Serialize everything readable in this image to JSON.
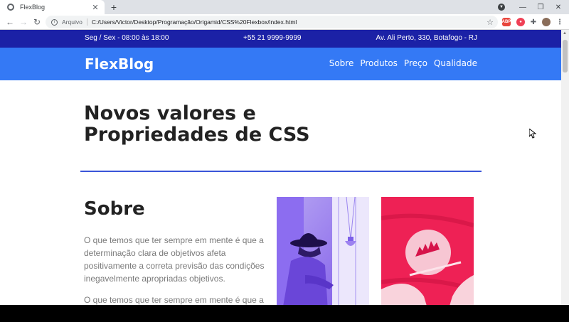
{
  "browser": {
    "tab_title": "FlexBlog",
    "tab_close": "✕",
    "new_tab": "+",
    "profile_badge": "▼",
    "scheme_label": "Arquivo",
    "url": "C:/Users/Victor/Desktop/Programação/Origamid/CSS%20Flexbox/index.html",
    "window": {
      "minimize": "—",
      "restore": "❐",
      "close": "✕"
    },
    "ext_colors": {
      "adblock": "#e8453c",
      "pocket": "#ef4056",
      "puzzle": "#5f6368",
      "avatar": "#8a6d5a"
    }
  },
  "topbar": {
    "hours": "Seg / Sex - 08:00 às 18:00",
    "phone": "+55 21 9999-9999",
    "address": "Av. Ali Perto, 330, Botafogo - RJ",
    "background": "#1b21a6"
  },
  "header": {
    "logo": "FlexBlog",
    "background": "#3479f5",
    "menu": [
      "Sobre",
      "Produtos",
      "Preço",
      "Qualidade"
    ]
  },
  "hero": {
    "title_line1": "Novos valores e",
    "title_line2": "Propriedades de CSS"
  },
  "sobre": {
    "title": "Sobre",
    "paragraph1": "O que temos que ter sempre em mente é que a determinação clara de objetivos afeta positivamente a correta previsão das condições inegavelmente apropriadas objetivos.",
    "paragraph2": "O que temos que ter sempre em mente é que a determinação clara de objetivos afeta"
  }
}
